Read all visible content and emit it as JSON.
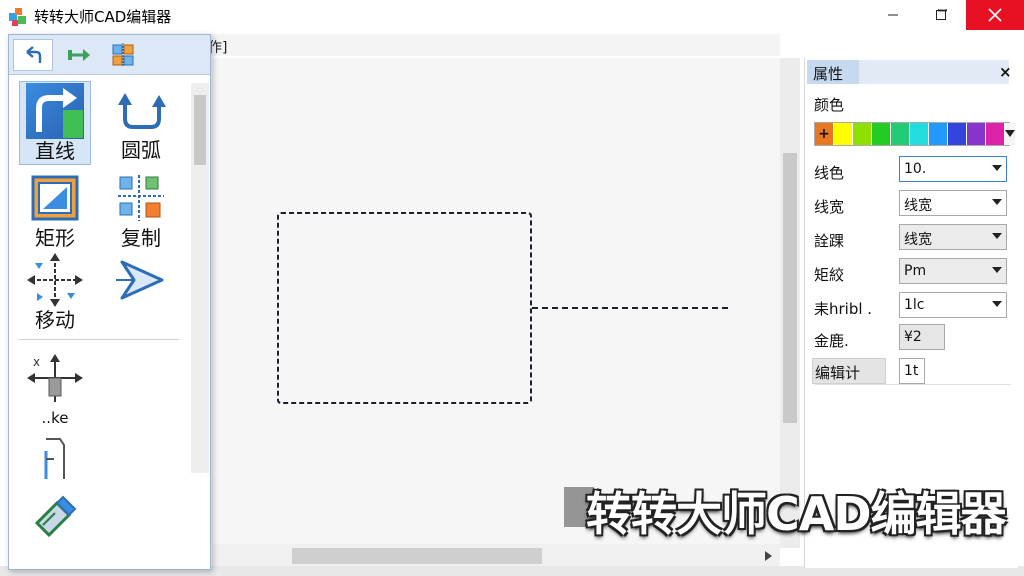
{
  "window": {
    "title": "转转大师CAD编辑器",
    "close_color": "#e81123"
  },
  "menu": {
    "fragment": "作]"
  },
  "toolbox": {
    "header_buttons": [
      {
        "name": "undo",
        "icon": "undo-arrow-icon"
      },
      {
        "name": "redo",
        "icon": "redo-arrow-icon"
      },
      {
        "name": "grid",
        "icon": "grid-select-icon"
      }
    ],
    "tools": [
      {
        "label": "直线",
        "icon": "line-icon",
        "selected": true
      },
      {
        "label": "圆弧",
        "icon": "arc-icon"
      },
      {
        "label": "矩形",
        "icon": "rectangle-icon"
      },
      {
        "label": "复制",
        "icon": "copy-icon"
      },
      {
        "label": "移动",
        "icon": "move-icon"
      },
      {
        "label": "",
        "icon": "arrow-cursor-icon"
      },
      {
        "label": "..ke",
        "icon": "trim-icon"
      },
      {
        "label": "",
        "icon": "offset-icon"
      },
      {
        "label": "",
        "icon": "eraser-icon"
      }
    ]
  },
  "properties": {
    "tab_label": "属性",
    "close_label": "×",
    "color_label": "颜色",
    "palette": [
      "#e87722",
      "#ffff00",
      "#8ee000",
      "#22cc22",
      "#22cc77",
      "#22dddd",
      "#2299ff",
      "#3344dd",
      "#8833cc",
      "#dd22aa",
      "#ee2233"
    ],
    "palette_mark": "+",
    "rows": [
      {
        "label": "线色",
        "value": "10.",
        "kind": "combo"
      },
      {
        "label": "线宽",
        "value": "线宽",
        "kind": "combo"
      },
      {
        "label": "詮踝",
        "value": "线宽",
        "kind": "combo"
      },
      {
        "label": "矩絞",
        "value": "Pm",
        "kind": "combo"
      },
      {
        "label": "耒hribl .",
        "value": "1lc",
        "kind": "combo"
      },
      {
        "label": "金鹿.",
        "value": "¥2",
        "kind": "field"
      },
      {
        "label": "编辑计",
        "value": "1t",
        "kind": "field"
      }
    ]
  },
  "watermark": {
    "text": "转转大师CAD编辑器"
  }
}
